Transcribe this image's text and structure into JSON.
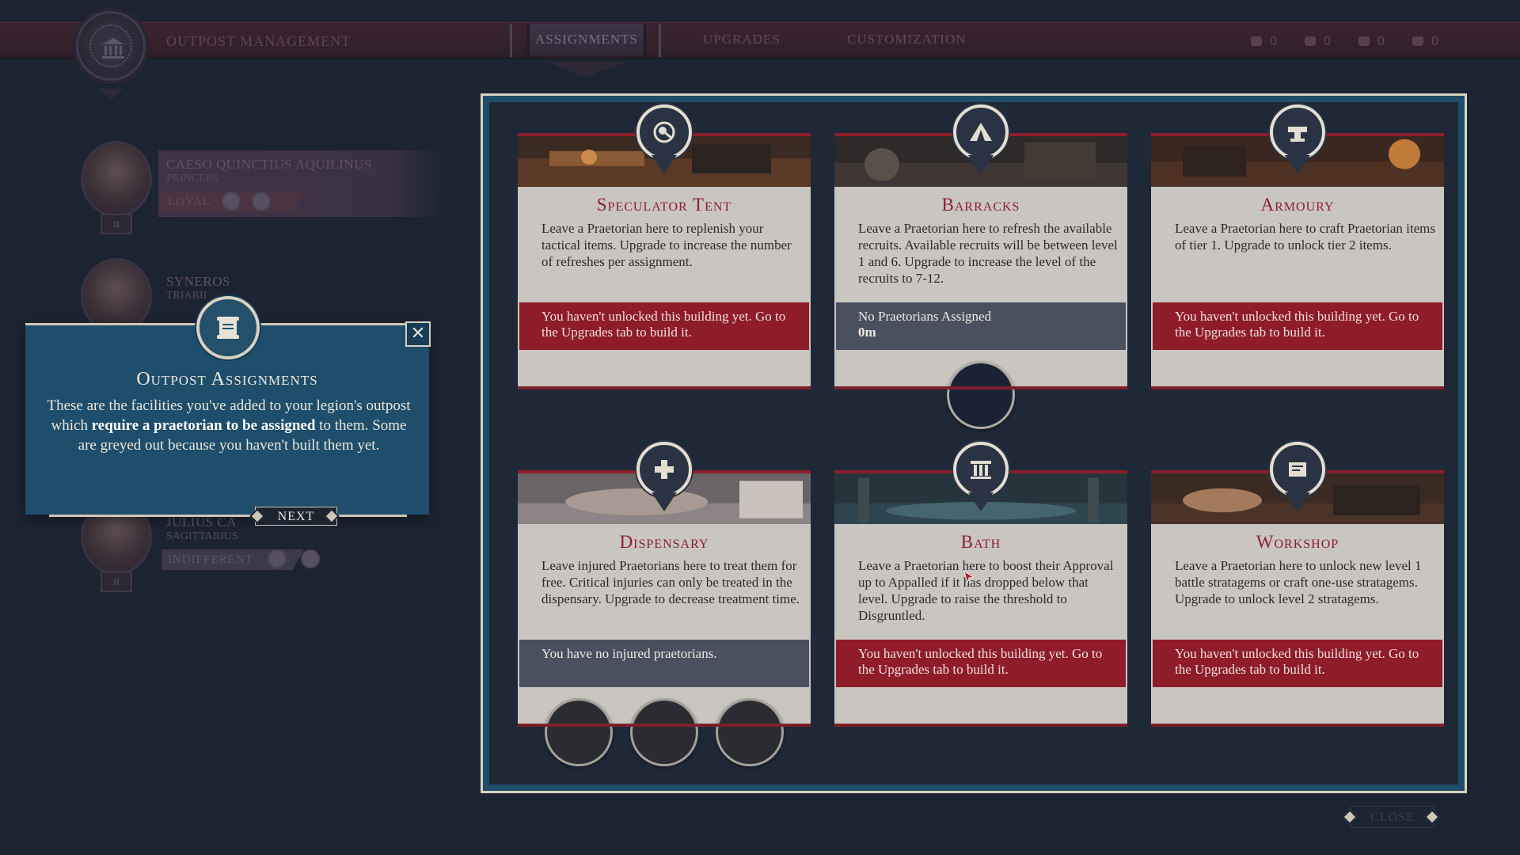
{
  "header": {
    "screen_title": "Outpost Management",
    "tabs": [
      {
        "label": "Assignments",
        "active": true
      },
      {
        "label": "Upgrades",
        "active": false
      },
      {
        "label": "Customization",
        "active": false
      }
    ],
    "resources": [
      {
        "icon": "cloud-icon",
        "value": "0"
      },
      {
        "icon": "horn-icon",
        "value": "0"
      },
      {
        "icon": "helmet-icon",
        "value": "0"
      },
      {
        "icon": "scroll-icon",
        "value": "0"
      }
    ]
  },
  "roster": [
    {
      "name": "Caeso Quinctius Aquilinus",
      "class": "Princeps",
      "status": "Loyal"
    },
    {
      "name": "Syneros",
      "class": "Triarii",
      "status": ""
    },
    {
      "name": "Julius Ca",
      "class": "Sagittarius",
      "status": "Indifferent"
    }
  ],
  "tutorial": {
    "title": "Outpost Assignments",
    "text_before": "These are the facilities you've added to your legion's outpost which ",
    "text_bold": "require a praetorian to be assigned",
    "text_after": " to them. Some are greyed out because you haven't built them yet.",
    "next_label": "NEXT",
    "close_symbol": "✕"
  },
  "buildings": [
    {
      "id": "speculator-tent",
      "title": "Speculator Tent",
      "description": "Leave a Praetorian here to replenish your tactical items. Upgrade to increase the number of refreshes per assignment.",
      "status_type": "locked",
      "status": "You haven't unlocked this building yet. Go to the Upgrades tab to build it.",
      "status_sub": "",
      "slots": 0
    },
    {
      "id": "barracks",
      "title": "Barracks",
      "description": "Leave a Praetorian here to refresh the available recruits. Available recruits will be between level 1 and 6. Upgrade to increase the level of the recruits to 7-12.",
      "status_type": "info",
      "status": "No Praetorians Assigned",
      "status_sub": "0m",
      "slots": 1
    },
    {
      "id": "armoury",
      "title": "Armoury",
      "description": "Leave a Praetorian here to craft Praetorian items of tier 1. Upgrade to unlock tier 2 items.",
      "status_type": "locked",
      "status": "You haven't unlocked this building yet. Go to the Upgrades tab to build it.",
      "status_sub": "",
      "slots": 0
    },
    {
      "id": "dispensary",
      "title": "Dispensary",
      "description": "Leave injured Praetorians here to treat them for free. Critical injuries can only be treated in the dispensary. Upgrade to decrease treatment time.",
      "status_type": "info",
      "status": "You have no injured praetorians.",
      "status_sub": "",
      "slots": 3
    },
    {
      "id": "bath",
      "title": "Bath",
      "description": "Leave a Praetorian here to boost their Approval up to Appalled if it has dropped below that level. Upgrade to raise the threshold to Disgruntled.",
      "status_type": "locked",
      "status": "You haven't unlocked this building yet. Go to the Upgrades tab to build it.",
      "status_sub": "",
      "slots": 0
    },
    {
      "id": "workshop",
      "title": "Workshop",
      "description": "Leave a Praetorian here to unlock new level 1 battle stratagems or craft one-use stratagems. Upgrade to unlock level 2 stratagems.",
      "status_type": "locked",
      "status": "You haven't unlocked this building yet. Go to the Upgrades tab to build it.",
      "status_sub": "",
      "slots": 0
    }
  ],
  "footer": {
    "close_label": "Close"
  },
  "colors": {
    "accent_red": "#8d1f2d",
    "panel_blue": "#1e4e6b",
    "card_bg": "#c9c5c1",
    "background": "#1c2331"
  }
}
